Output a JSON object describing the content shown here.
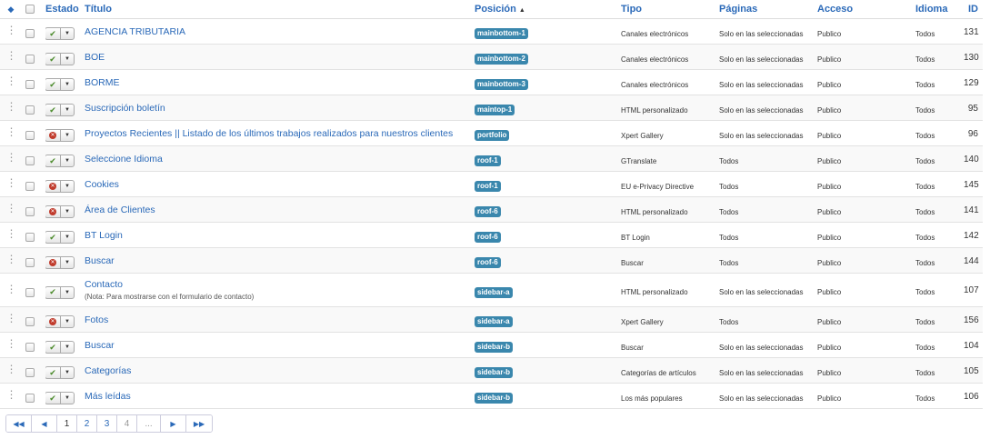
{
  "headers": {
    "sort_icon": "sort-icon",
    "estado": "Estado",
    "titulo": "Título",
    "posicion": "Posición",
    "posicion_sort_indicator": "▲",
    "tipo": "Tipo",
    "paginas": "Páginas",
    "acceso": "Acceso",
    "idioma": "Idioma",
    "id": "ID"
  },
  "rows": [
    {
      "status": "published",
      "title": "AGENCIA TRIBUTARIA",
      "note": "",
      "position": "mainbottom-1",
      "type": "Canales electrónicos",
      "pages": "Solo en las seleccionadas",
      "access": "Publico",
      "language": "Todos",
      "id": "131"
    },
    {
      "status": "published",
      "title": "BOE",
      "note": "",
      "position": "mainbottom-2",
      "type": "Canales electrónicos",
      "pages": "Solo en las seleccionadas",
      "access": "Publico",
      "language": "Todos",
      "id": "130"
    },
    {
      "status": "published",
      "title": "BORME",
      "note": "",
      "position": "mainbottom-3",
      "type": "Canales electrónicos",
      "pages": "Solo en las seleccionadas",
      "access": "Publico",
      "language": "Todos",
      "id": "129"
    },
    {
      "status": "published",
      "title": "Suscripción boletín",
      "note": "",
      "position": "maintop-1",
      "type": "HTML personalizado",
      "pages": "Solo en las seleccionadas",
      "access": "Publico",
      "language": "Todos",
      "id": "95"
    },
    {
      "status": "unpublished",
      "title": "Proyectos Recientes || Listado de los últimos trabajos realizados para nuestros clientes",
      "note": "",
      "position": "portfolio",
      "type": "Xpert Gallery",
      "pages": "Solo en las seleccionadas",
      "access": "Publico",
      "language": "Todos",
      "id": "96"
    },
    {
      "status": "published",
      "title": "Seleccione Idioma",
      "note": "",
      "position": "roof-1",
      "type": "GTranslate",
      "pages": "Todos",
      "access": "Publico",
      "language": "Todos",
      "id": "140"
    },
    {
      "status": "unpublished",
      "title": "Cookies",
      "note": "",
      "position": "roof-1",
      "type": "EU e-Privacy Directive",
      "pages": "Todos",
      "access": "Publico",
      "language": "Todos",
      "id": "145"
    },
    {
      "status": "unpublished",
      "title": "Área de Clientes",
      "note": "",
      "position": "roof-6",
      "type": "HTML personalizado",
      "pages": "Todos",
      "access": "Publico",
      "language": "Todos",
      "id": "141"
    },
    {
      "status": "published",
      "title": "BT Login",
      "note": "",
      "position": "roof-6",
      "type": "BT Login",
      "pages": "Todos",
      "access": "Publico",
      "language": "Todos",
      "id": "142"
    },
    {
      "status": "unpublished",
      "title": "Buscar",
      "note": "",
      "position": "roof-6",
      "type": "Buscar",
      "pages": "Todos",
      "access": "Publico",
      "language": "Todos",
      "id": "144"
    },
    {
      "status": "published",
      "title": "Contacto",
      "note": "(Nota: Para mostrarse con el formulario de contacto)",
      "position": "sidebar-a",
      "type": "HTML personalizado",
      "pages": "Solo en las seleccionadas",
      "access": "Publico",
      "language": "Todos",
      "id": "107"
    },
    {
      "status": "unpublished",
      "title": "Fotos",
      "note": "",
      "position": "sidebar-a",
      "type": "Xpert Gallery",
      "pages": "Todos",
      "access": "Publico",
      "language": "Todos",
      "id": "156"
    },
    {
      "status": "published",
      "title": "Buscar",
      "note": "",
      "position": "sidebar-b",
      "type": "Buscar",
      "pages": "Solo en las seleccionadas",
      "access": "Publico",
      "language": "Todos",
      "id": "104"
    },
    {
      "status": "published",
      "title": "Categorías",
      "note": "",
      "position": "sidebar-b",
      "type": "Categorías de artículos",
      "pages": "Solo en las seleccionadas",
      "access": "Publico",
      "language": "Todos",
      "id": "105"
    },
    {
      "status": "published",
      "title": "Más leídas",
      "note": "",
      "position": "sidebar-b",
      "type": "Los más populares",
      "pages": "Solo en las seleccionadas",
      "access": "Publico",
      "language": "Todos",
      "id": "106"
    }
  ],
  "pagination": {
    "first_icon": "first-page-icon",
    "prev_icon": "prev-page-icon",
    "pages": [
      "1",
      "2",
      "3",
      "4"
    ],
    "current": "1",
    "ellipsis": "...",
    "next_icon": "next-page-icon",
    "last_icon": "last-page-icon"
  },
  "colors": {
    "link": "#2a69b8",
    "position_badge": "#3a87ad",
    "published_check": "#4a8a2a",
    "unpublished_dot": "#c03a2b"
  }
}
